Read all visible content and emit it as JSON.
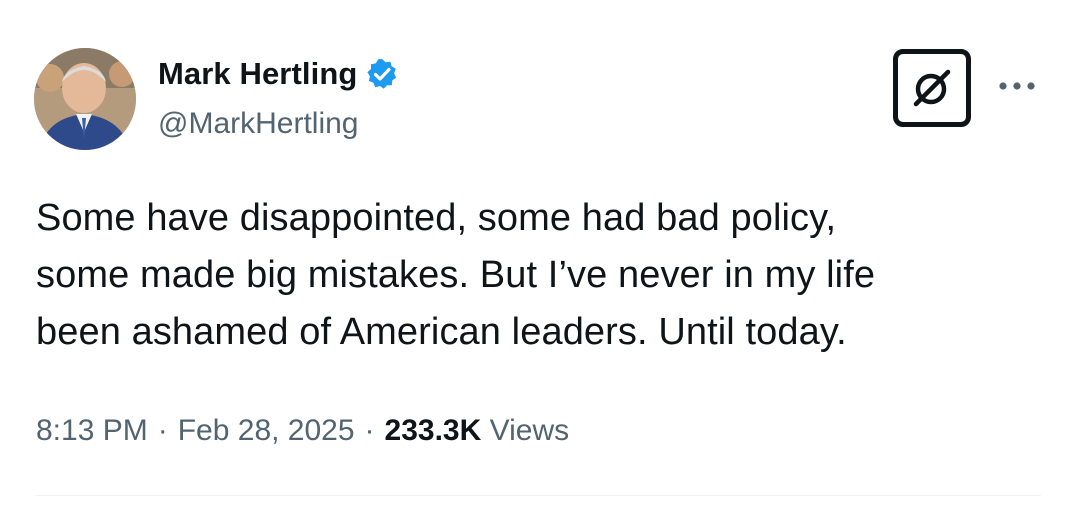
{
  "author": {
    "display_name": "Mark Hertling",
    "handle": "@MarkHertling",
    "avatar_icon": "profile-photo",
    "verified_icon": "verified-badge-icon",
    "verified_color": "#1d9bf0"
  },
  "actions": {
    "grok_icon": "grok-icon",
    "more_icon": "more-dots-icon"
  },
  "tweet": {
    "text_lines": [
      "Some have disappointed, some had bad policy,",
      "some made big mistakes. But I’ve never in my life",
      "been ashamed of American leaders. Until today."
    ]
  },
  "meta": {
    "time": "8:13 PM",
    "separator": "·",
    "date": "Feb 28, 2025",
    "views_count": "233.3K",
    "views_label": "Views"
  },
  "colors": {
    "text_primary": "#0f1419",
    "text_secondary": "#536471",
    "divider": "#eff3f4"
  }
}
